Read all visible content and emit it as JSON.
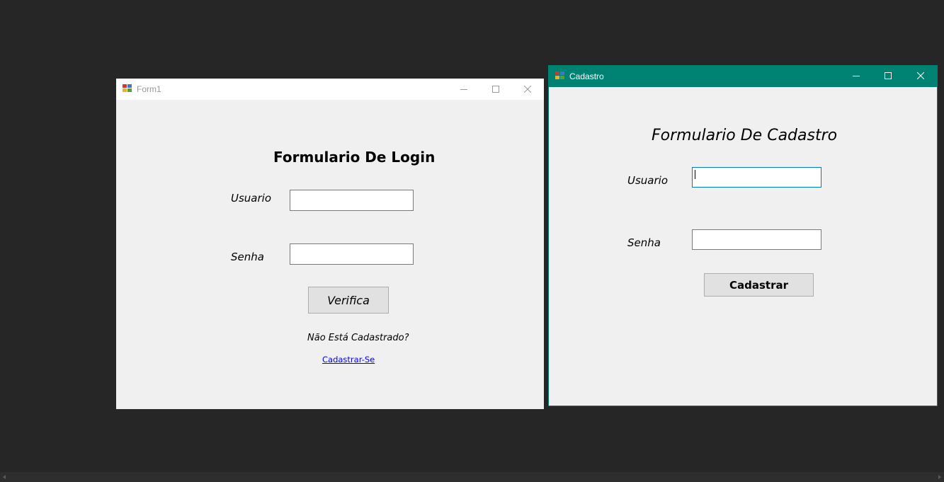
{
  "colors": {
    "desktop": "#262626",
    "active_titlebar": "#008272",
    "inactive_titlebar": "#ffffff",
    "form_background": "#f0f0f0",
    "link": "#0000ff"
  },
  "login_window": {
    "title": "Form1",
    "icon": "form-app-icon",
    "heading": "Formulario De Login",
    "usuario_label": "Usuario",
    "usuario_value": "",
    "senha_label": "Senha",
    "senha_value": "",
    "verify_button": "Verifica",
    "not_registered_text": "Não Está Cadastrado?",
    "register_link": "Cadastrar-Se"
  },
  "register_window": {
    "title": "Cadastro",
    "icon": "form-app-icon",
    "heading": "Formulario De Cadastro",
    "usuario_label": "Usuario",
    "usuario_value": "",
    "senha_label": "Senha",
    "senha_value": "",
    "register_button": "Cadastrar"
  },
  "window_controls": [
    "minimize-icon",
    "maximize-icon",
    "close-icon"
  ]
}
